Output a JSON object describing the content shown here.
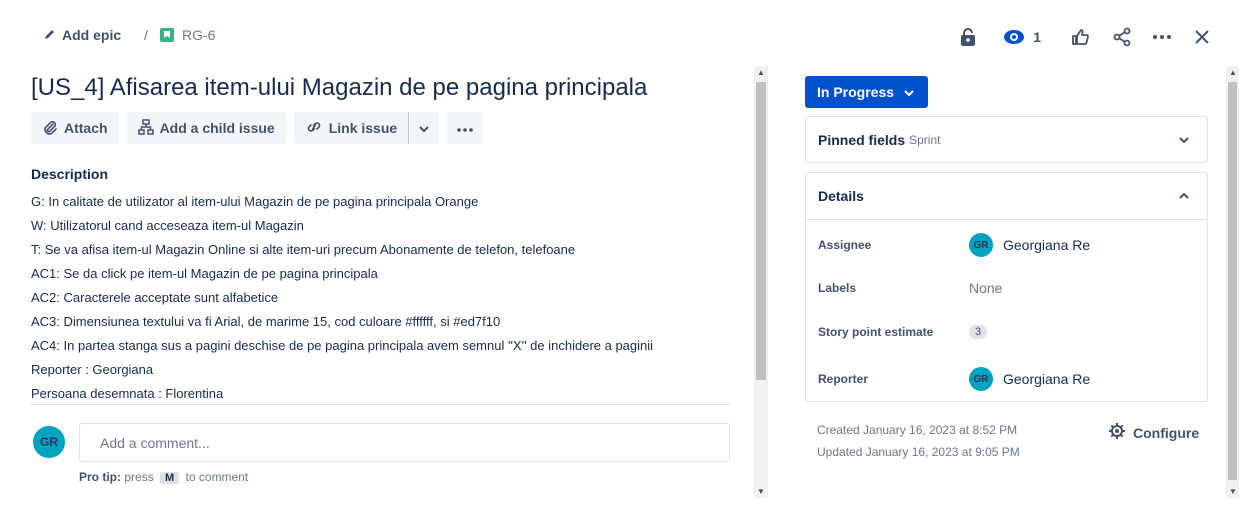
{
  "breadcrumb": {
    "epic_label": "Add epic",
    "separator": "/",
    "issue_key": "RG-6"
  },
  "header_actions": {
    "watch_count": "1",
    "icons": [
      "lock-icon",
      "eye-icon",
      "thumbs-up-icon",
      "share-icon",
      "more-icon",
      "close-icon"
    ]
  },
  "issue": {
    "title": "[US_4] Afisarea item-ului Magazin de pe pagina principala",
    "toolbar": {
      "attach": "Attach",
      "add_child": "Add a child issue",
      "link_issue": "Link issue"
    },
    "description_heading": "Description",
    "description": [
      "G: In calitate de utilizator al item-ului Magazin de pe pagina principala Orange",
      "W: Utilizatorul cand acceseaza item-ul Magazin",
      "T: Se va afisa item-ul Magazin Online si alte item-uri precum Abonamente de telefon, telefoane",
      "AC1: Se da click pe item-ul Magazin de pe pagina principala",
      "AC2: Caracterele acceptate sunt alfabetice",
      "AC3: Dimensiunea textului va fi Arial, de marime 15, cod culoare #ffffff, si #ed7f10",
      "AC4: In partea stanga sus a pagini deschise de pe pagina principala avem semnul ''X'' de inchidere a paginii",
      "Reporter : Georgiana",
      "Persoana desemnata : Florentina"
    ]
  },
  "comment": {
    "avatar_initials": "GR",
    "placeholder": "Add a comment...",
    "protip_label": "Pro tip:",
    "protip_pre": "press",
    "protip_key": "M",
    "protip_post": "to comment"
  },
  "sidebar": {
    "status": "In Progress",
    "pinned": {
      "label": "Pinned fields",
      "sub": "Sprint"
    },
    "details": {
      "heading": "Details",
      "assignee_label": "Assignee",
      "assignee_name": "Georgiana Re",
      "assignee_initials": "GR",
      "labels_label": "Labels",
      "labels_value": "None",
      "story_points_label": "Story point estimate",
      "story_points_value": "3",
      "reporter_label": "Reporter",
      "reporter_name": "Georgiana Re",
      "reporter_initials": "GR"
    },
    "created": "Created January 16, 2023 at 8:52 PM",
    "updated": "Updated January 16, 2023 at 9:05 PM",
    "configure": "Configure"
  },
  "colors": {
    "primary": "#0052cc",
    "avatar": "#00a3bf",
    "story": "#36b37e"
  }
}
